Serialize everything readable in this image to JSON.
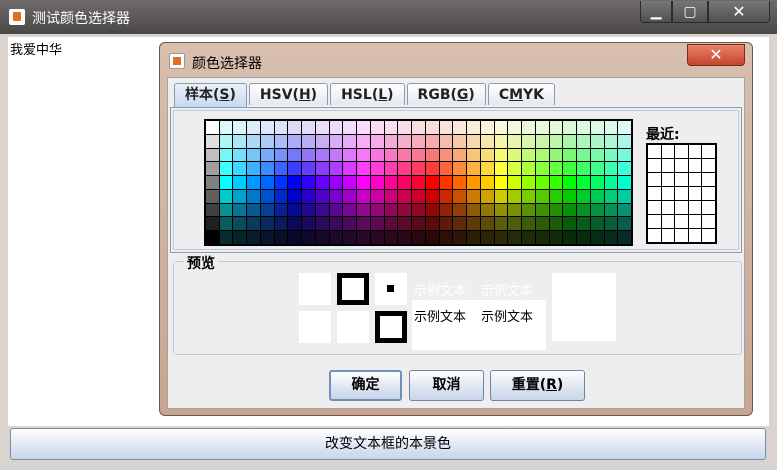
{
  "window": {
    "title": "测试颜色选择器",
    "controls": {
      "minimize": "▁",
      "maximize": "▢",
      "close": "✕"
    }
  },
  "text_area": {
    "content": "我爱中华"
  },
  "bottom_button": {
    "label": "改变文本框的本景色"
  },
  "dialog": {
    "title": "颜色选择器",
    "close": "✕",
    "tabs": [
      {
        "label": "样本",
        "mnemonic": "S"
      },
      {
        "label": "HSV",
        "mnemonic": "H"
      },
      {
        "label": "HSL",
        "mnemonic": "L"
      },
      {
        "label": "RGB",
        "mnemonic": "G"
      },
      {
        "label": "CMYK",
        "mnemonic": "M"
      }
    ],
    "recent_label": "最近:",
    "preview_label": "预览",
    "sample_text": "示例文本",
    "buttons": {
      "ok": "确定",
      "cancel": "取消",
      "reset_label": "重置",
      "reset_mnemonic": "R"
    }
  },
  "colors": {
    "accent": "#c9a590",
    "close_red": "#c6442c",
    "tab_active": "#c8d9ef"
  }
}
